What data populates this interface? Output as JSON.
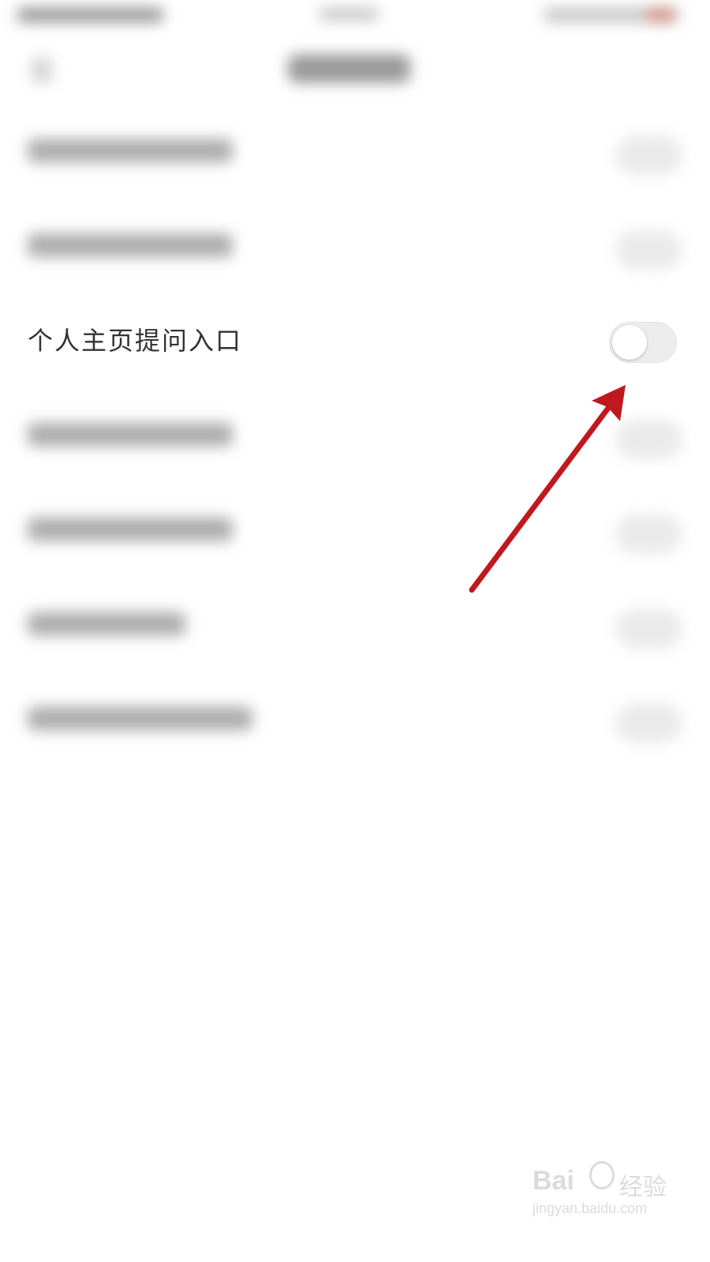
{
  "setting": {
    "label": "个人主页提问入口",
    "toggle_on": false
  },
  "annotation": {
    "arrow_color": "#c0181f"
  },
  "watermark": {
    "brand": "Bai",
    "text": "经验",
    "url": "jingyan.baidu.com"
  }
}
